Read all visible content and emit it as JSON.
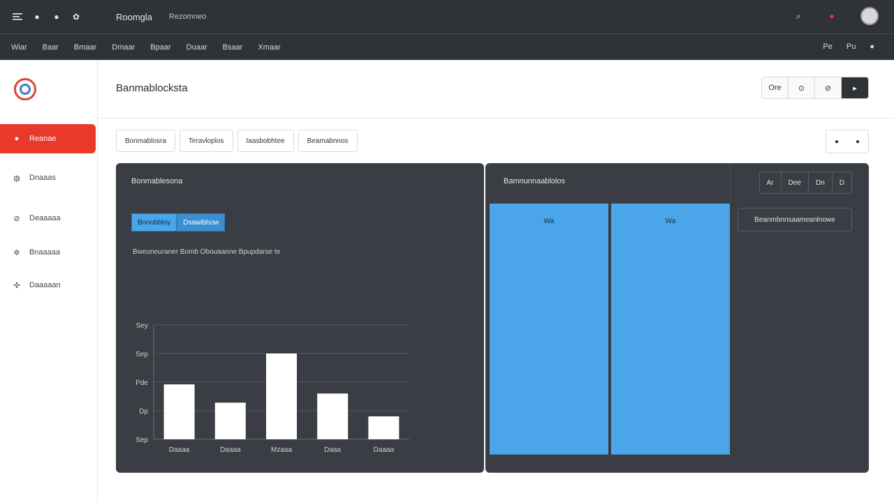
{
  "topbar": {
    "app_title": "Roomgla",
    "app_subtitle": "Rezomneo",
    "icons": [
      "menu-icon",
      "dot-icon",
      "dot-icon",
      "settings-icon"
    ]
  },
  "menubar": {
    "items": [
      "Wiar",
      "Baar",
      "Bmaar",
      "Dmaar",
      "Bpaar",
      "Duaar",
      "Bsaar",
      "Xmaar"
    ],
    "right": [
      "Pe",
      "Pu"
    ]
  },
  "sidebar": {
    "items": [
      {
        "label": "Reanae",
        "icon": "alert-icon",
        "active": true
      },
      {
        "label": "Dnaaas",
        "icon": "globe-icon",
        "active": false
      },
      {
        "label": "Deaaaaa",
        "icon": "link-icon",
        "active": false
      },
      {
        "label": "Bnaaaaa",
        "icon": "gear-icon",
        "active": false
      },
      {
        "label": "Daaaaan",
        "icon": "tool-icon",
        "active": false
      }
    ]
  },
  "header": {
    "title": "Banmablocksta",
    "actions": [
      "Ore",
      "⊙",
      "⊘",
      "▸"
    ]
  },
  "tabs": [
    "Bonmablosra",
    "Teravloplos",
    "Iaasbobhtee",
    "Beamabnnos"
  ],
  "left_panel": {
    "title": "Bonmablesona",
    "pills": [
      "Bonnbbloy",
      "Dsawibhow"
    ],
    "desc": "Bweuneuraner Bomb Obouaanne  Bpupdarse te"
  },
  "right_panel": {
    "title": "Bamnunnaablolos",
    "segments": [
      "Ar",
      "Dee",
      "Dn",
      "D"
    ],
    "button": "Beanmbnnsaameanlnowe",
    "bars": [
      {
        "label": "Wa",
        "color": "#4aa6e8"
      },
      {
        "label": "Wa",
        "color": "#4aa6e8"
      }
    ]
  },
  "chart_data": {
    "type": "bar",
    "categories": [
      "Daaaa",
      "Daaaa",
      "Mzaaa",
      "Daaa",
      "Daaaa"
    ],
    "values": [
      48,
      32,
      75,
      40,
      20
    ],
    "ylim": [
      0,
      100
    ],
    "ytick_labels": [
      "Sey",
      "Sep",
      "Pde",
      "Dp",
      "Sep"
    ],
    "grid": true,
    "bar_color": "#ffffff"
  }
}
